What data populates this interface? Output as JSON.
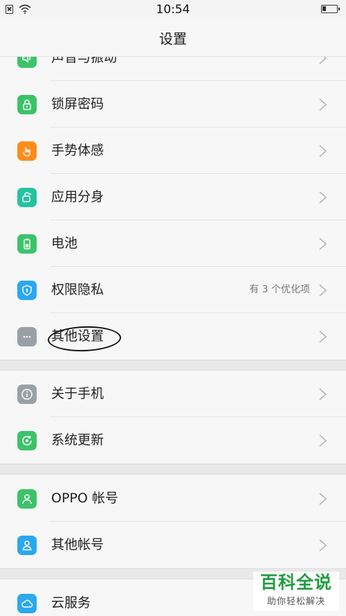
{
  "status": {
    "time": "10:54",
    "sim_icon": "sim-error-icon",
    "wifi_icon": "wifi-icon",
    "battery_icon": "battery-low-icon"
  },
  "header": {
    "title": "设置"
  },
  "rows": [
    {
      "label": "声音与振动",
      "icon": "speaker-icon",
      "color": "#3cc36a",
      "hint": ""
    },
    {
      "label": "锁屏密码",
      "icon": "lock-icon",
      "color": "#3cc36a",
      "hint": ""
    },
    {
      "label": "手势体感",
      "icon": "hand-gesture-icon",
      "color": "#ff8c1a",
      "hint": ""
    },
    {
      "label": "应用分身",
      "icon": "app-clone-icon",
      "color": "#25c3a0",
      "hint": ""
    },
    {
      "label": "电池",
      "icon": "battery-icon",
      "color": "#3cc36a",
      "hint": ""
    },
    {
      "label": "权限隐私",
      "icon": "shield-icon",
      "color": "#2aa8f0",
      "hint": "有 3 个优化项"
    },
    {
      "label": "其他设置",
      "icon": "more-dots-icon",
      "color": "#9aa0a8",
      "hint": ""
    },
    {
      "label": "关于手机",
      "icon": "info-icon",
      "color": "#9aa0a8",
      "hint": ""
    },
    {
      "label": "系统更新",
      "icon": "update-icon",
      "color": "#3cc36a",
      "hint": ""
    },
    {
      "label": "OPPO 帐号",
      "icon": "user-icon",
      "color": "#3cc36a",
      "hint": ""
    },
    {
      "label": "其他帐号",
      "icon": "user-outline-icon",
      "color": "#2aa8f0",
      "hint": ""
    },
    {
      "label": "云服务",
      "icon": "cloud-icon",
      "color": "#2aa8f0",
      "hint": ""
    }
  ],
  "watermark": {
    "title": "百科全说",
    "subtitle": "助你轻松解决"
  }
}
